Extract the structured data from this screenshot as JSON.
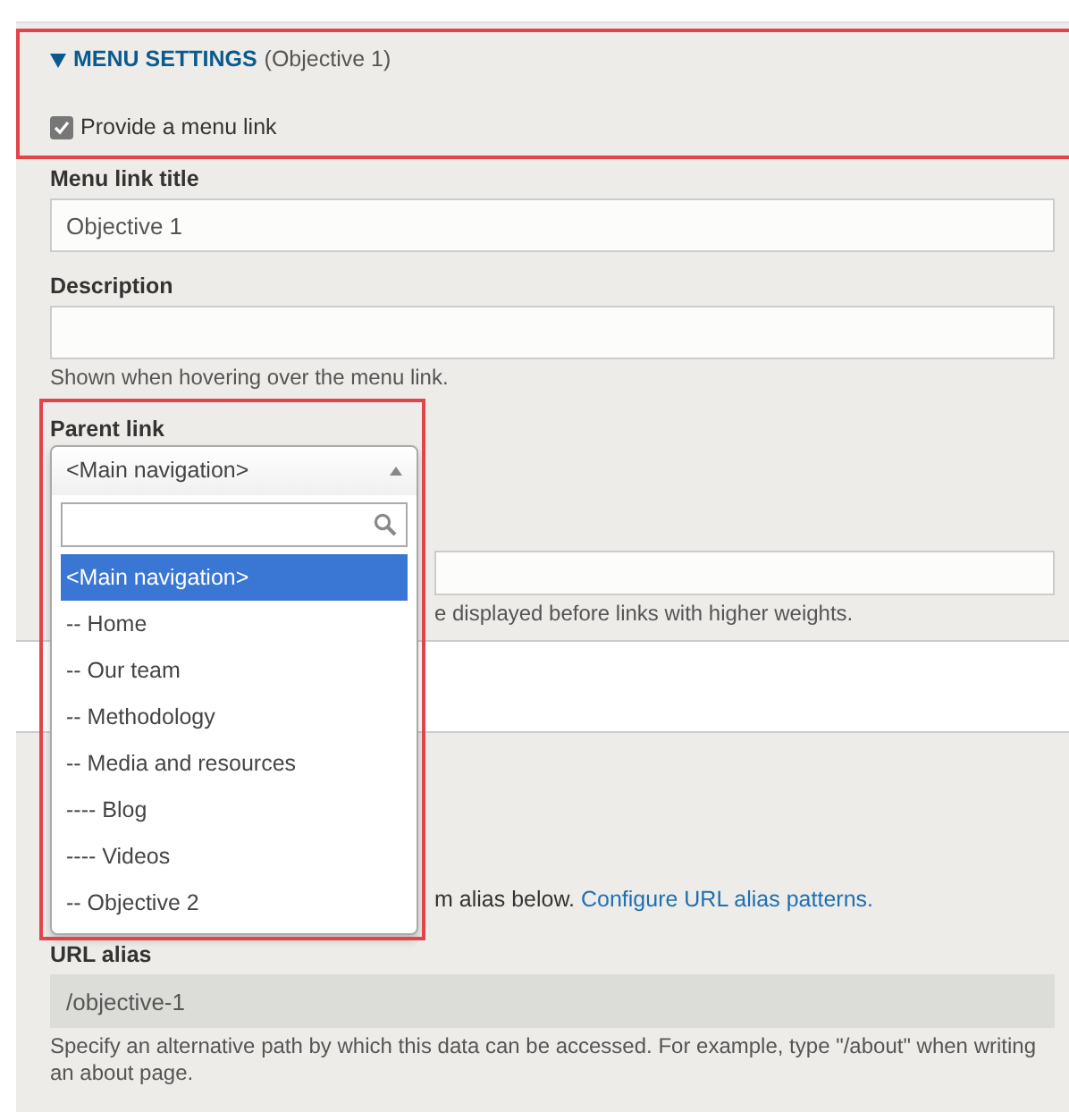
{
  "menu_settings": {
    "expanded": true,
    "title": "MENU SETTINGS",
    "summary": "(Objective 1)",
    "provide_menu_link": {
      "label": "Provide a menu link",
      "checked": true
    },
    "menu_link_title": {
      "label": "Menu link title",
      "value": "Objective 1"
    },
    "description": {
      "label": "Description",
      "help": "Shown when hovering over the menu link."
    },
    "parent_link": {
      "label": "Parent link",
      "value": "<Main navigation>",
      "options": [
        {
          "label": "<Main navigation>",
          "selected": true
        },
        {
          "label": "-- Home",
          "selected": false
        },
        {
          "label": "-- Our team",
          "selected": false
        },
        {
          "label": "-- Methodology",
          "selected": false
        },
        {
          "label": "-- Media and resources",
          "selected": false
        },
        {
          "label": "---- Blog",
          "selected": false
        },
        {
          "label": "---- Videos",
          "selected": false
        },
        {
          "label": "-- Objective 2",
          "selected": false
        }
      ]
    },
    "weight_help": "e displayed before links with higher weights."
  },
  "url_alias_settings": {
    "intro": "m alias below.",
    "link": "Configure URL alias patterns.",
    "label": "URL alias",
    "value": "/objective-1",
    "help": "Specify an alternative path by which this data can be accessed. For example, type \"/about\" when writing an about page."
  }
}
